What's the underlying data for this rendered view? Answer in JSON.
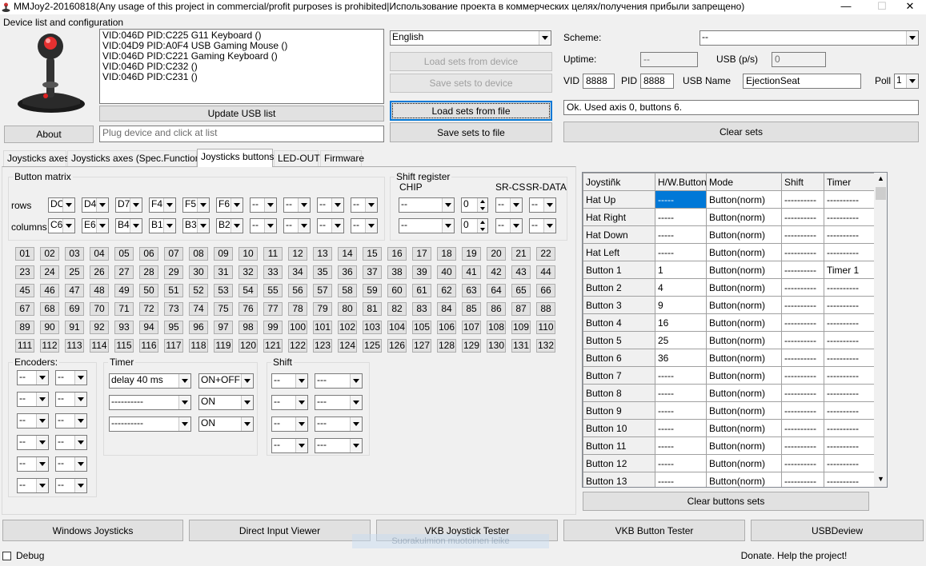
{
  "title": "MMJoy2-20160818(Any usage of this project in commercial/profit purposes is prohibited|Использование проекта в коммерческих целях/получения прибыли запрещено)",
  "window": {
    "minimize": "—",
    "maximize": "☐",
    "close": "✕"
  },
  "device": {
    "group_label": "Device list and configuration",
    "items": [
      "VID:046D PID:C225 G11 Keyboard ()",
      "VID:04D9 PID:A0F4 USB Gaming Mouse ()",
      "VID:046D PID:C221 Gaming Keyboard ()",
      "VID:046D PID:C232 ()",
      "VID:046D PID:C231 ()"
    ],
    "update_btn": "Update USB list",
    "about_btn": "About",
    "plug_placeholder": "Plug device and click at list"
  },
  "lang": "English",
  "buttons": {
    "load_device": "Load sets from device",
    "save_device": "Save sets to device",
    "load_file": "Load sets from file",
    "save_file": "Save sets to file",
    "clear_sets": "Clear sets"
  },
  "config": {
    "scheme_label": "Scheme:",
    "scheme_value": "--",
    "uptime_label": "Uptime:",
    "uptime_value": "--",
    "usb_ps_label": "USB (p/s)",
    "usb_ps_value": "0",
    "vid_label": "VID",
    "vid_value": "8888",
    "pid_label": "PID",
    "pid_value": "8888",
    "usbname_label": "USB Name",
    "usbname_value": "EjectionSeat",
    "poll_label": "Poll",
    "poll_value": "1",
    "status": "Ok. Used axis  0, buttons 6."
  },
  "tabs": [
    "Joysticks axes",
    "Joysticks axes (Spec.Functions)",
    "Joysticks buttons",
    "LED-OUT",
    "Firmware"
  ],
  "matrix": {
    "label": "Button matrix",
    "rows_label": "rows",
    "cols_label": "columns",
    "rows": [
      "DC",
      "D4",
      "D7",
      "F4",
      "F5",
      "F6",
      "--",
      "--",
      "--",
      "--"
    ],
    "cols": [
      "C6",
      "E6",
      "B4",
      "B1",
      "B3",
      "B2",
      "--",
      "--",
      "--",
      "--"
    ]
  },
  "shift_register": {
    "label": "Shift register",
    "chip_label": "CHIP",
    "srcs_label": "SR-CS",
    "srdata_label": "SR-DATA",
    "chip": [
      "--",
      "--"
    ],
    "count": [
      "0",
      "0"
    ],
    "cs": [
      "--",
      "--"
    ],
    "data": [
      "--",
      "--"
    ]
  },
  "numbers": [
    "01",
    "02",
    "03",
    "04",
    "05",
    "06",
    "07",
    "08",
    "09",
    "10",
    "11",
    "12",
    "13",
    "14",
    "15",
    "16",
    "17",
    "18",
    "19",
    "20",
    "21",
    "22",
    "23",
    "24",
    "25",
    "26",
    "27",
    "28",
    "29",
    "30",
    "31",
    "32",
    "33",
    "34",
    "35",
    "36",
    "37",
    "38",
    "39",
    "40",
    "41",
    "42",
    "43",
    "44",
    "45",
    "46",
    "47",
    "48",
    "49",
    "50",
    "51",
    "52",
    "53",
    "54",
    "55",
    "56",
    "57",
    "58",
    "59",
    "60",
    "61",
    "62",
    "63",
    "64",
    "65",
    "66",
    "67",
    "68",
    "69",
    "70",
    "71",
    "72",
    "73",
    "74",
    "75",
    "76",
    "77",
    "78",
    "79",
    "80",
    "81",
    "82",
    "83",
    "84",
    "85",
    "86",
    "87",
    "88",
    "89",
    "90",
    "91",
    "92",
    "93",
    "94",
    "95",
    "96",
    "97",
    "98",
    "99",
    "100",
    "101",
    "102",
    "103",
    "104",
    "105",
    "106",
    "107",
    "108",
    "109",
    "110",
    "111",
    "112",
    "113",
    "114",
    "115",
    "116",
    "117",
    "118",
    "119",
    "120",
    "121",
    "122",
    "123",
    "124",
    "125",
    "126",
    "127",
    "128",
    "129",
    "130",
    "131",
    "132"
  ],
  "encoders": {
    "label": "Encoders:",
    "value": "--"
  },
  "timer": {
    "label": "Timer",
    "delays": [
      "delay 40 ms",
      "----------",
      "----------"
    ],
    "modes": [
      "ON+OFF",
      "ON",
      "ON"
    ]
  },
  "shift": {
    "label": "Shift",
    "value": "--",
    "value2": "---"
  },
  "table": {
    "headers": [
      "Joystiñk",
      "H/W.Button",
      "Mode",
      "Shift",
      "Timer"
    ],
    "rows": [
      [
        "Hat Up",
        "-----",
        "Button(norm)",
        "----------",
        "----------"
      ],
      [
        "Hat Right",
        "-----",
        "Button(norm)",
        "----------",
        "----------"
      ],
      [
        "Hat Down",
        "-----",
        "Button(norm)",
        "----------",
        "----------"
      ],
      [
        "Hat Left",
        "-----",
        "Button(norm)",
        "----------",
        "----------"
      ],
      [
        "Button 1",
        "1",
        "Button(norm)",
        "----------",
        "Timer 1"
      ],
      [
        "Button 2",
        "4",
        "Button(norm)",
        "----------",
        "----------"
      ],
      [
        "Button 3",
        "9",
        "Button(norm)",
        "----------",
        "----------"
      ],
      [
        "Button 4",
        "16",
        "Button(norm)",
        "----------",
        "----------"
      ],
      [
        "Button 5",
        "25",
        "Button(norm)",
        "----------",
        "----------"
      ],
      [
        "Button 6",
        "36",
        "Button(norm)",
        "----------",
        "----------"
      ],
      [
        "Button 7",
        "-----",
        "Button(norm)",
        "----------",
        "----------"
      ],
      [
        "Button 8",
        "-----",
        "Button(norm)",
        "----------",
        "----------"
      ],
      [
        "Button 9",
        "-----",
        "Button(norm)",
        "----------",
        "----------"
      ],
      [
        "Button 10",
        "-----",
        "Button(norm)",
        "----------",
        "----------"
      ],
      [
        "Button 11",
        "-----",
        "Button(norm)",
        "----------",
        "----------"
      ],
      [
        "Button 12",
        "-----",
        "Button(norm)",
        "----------",
        "----------"
      ],
      [
        "Button 13",
        "-----",
        "Button(norm)",
        "----------",
        "----------"
      ]
    ],
    "clear_btn": "Clear buttons sets"
  },
  "bottom": {
    "b1": "Windows Joysticks",
    "b2": "Direct Input Viewer",
    "b3": "VKB Joystick Tester",
    "b4": "VKB Button Tester",
    "b5": "USBDeview",
    "debug": "Debug",
    "donate": "Donate. Help the project!",
    "ghost": "Suorakulmion muotoinen leike"
  }
}
